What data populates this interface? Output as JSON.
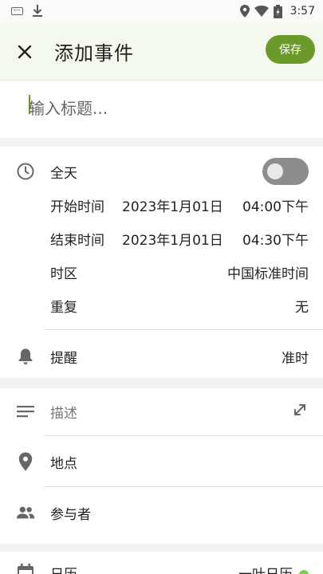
{
  "status_bar": {
    "time": "3:57",
    "icons": [
      "keyboard-icon",
      "download-icon",
      "location-icon",
      "wifi-icon",
      "battery-icon"
    ]
  },
  "header": {
    "title": "添加事件",
    "save_label": "保存"
  },
  "title_input": {
    "placeholder": "输入标题..."
  },
  "time_section": {
    "all_day_label": "全天",
    "all_day_on": false,
    "start_label": "开始时间",
    "start_date": "2023年1月01日",
    "start_time": "04:00下午",
    "end_label": "结束时间",
    "end_date": "2023年1月01日",
    "end_time": "04:30下午",
    "timezone_label": "时区",
    "timezone_value": "中国标准时间",
    "repeat_label": "重复",
    "repeat_value": "无",
    "reminder_label": "提醒",
    "reminder_value": "准时"
  },
  "details_section": {
    "description_placeholder": "描述",
    "location_label": "地点",
    "participants_label": "参与者"
  },
  "calendar_section": {
    "label": "日历",
    "value": "一叶日历"
  },
  "colors": {
    "accent": "#6c9a2a",
    "calendar_dot": "#7ccf3f",
    "appbar_bg": "#f5f8ee"
  }
}
